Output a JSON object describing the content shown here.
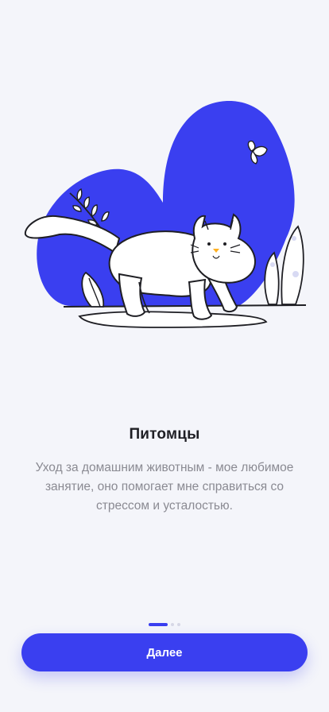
{
  "onboarding": {
    "title": "Питомцы",
    "description": "Уход за домашним животным - мое любимое занятие, оно помогает мне справиться со стрессом и усталостью.",
    "pager": {
      "total": 3,
      "current": 1
    },
    "next_label": "Далее"
  },
  "colors": {
    "accent": "#3a3ff0",
    "background": "#f4f5fa"
  },
  "illustration": {
    "icon": "cat-illustration"
  }
}
